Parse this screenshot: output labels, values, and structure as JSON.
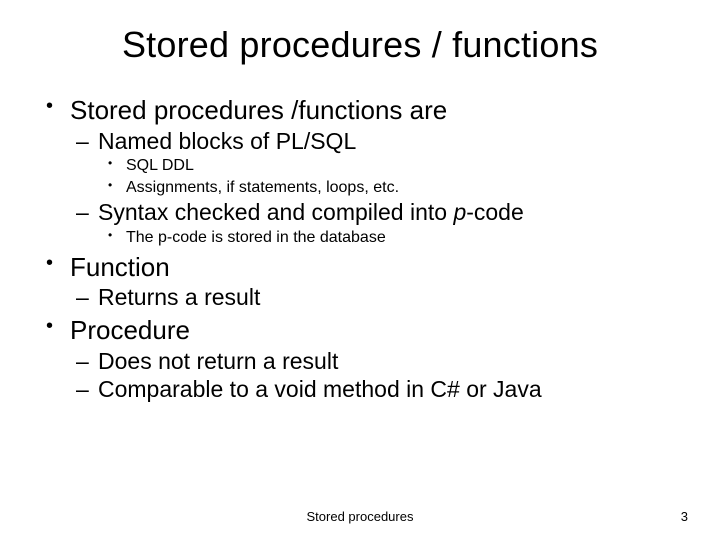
{
  "title": "Stored procedures / functions",
  "bullets": {
    "b1": "Stored procedures /functions are",
    "b1_1": "Named blocks of PL/SQL",
    "b1_1_1": "SQL DDL",
    "b1_1_2": "Assignments, if statements, loops, etc.",
    "b1_2_pre": "Syntax checked and compiled into ",
    "b1_2_it": "p",
    "b1_2_post": "-code",
    "b1_2_1": "The p-code is stored in the database",
    "b2": "Function",
    "b2_1": "Returns a result",
    "b3": "Procedure",
    "b3_1": "Does not return a result",
    "b3_2": "Comparable to a void method in C# or Java"
  },
  "footer": "Stored procedures",
  "page": "3"
}
